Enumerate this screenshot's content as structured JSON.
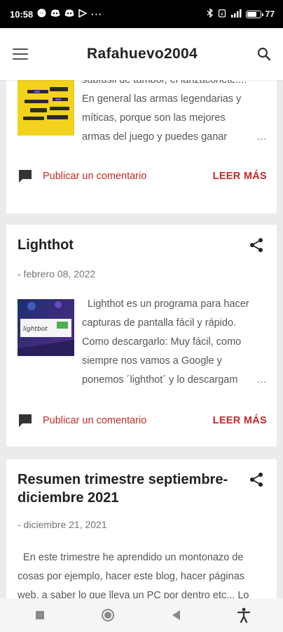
{
  "status_bar": {
    "time": "10:58",
    "notification_icons": [
      "messenger-icon",
      "discord-icon",
      "discord-icon",
      "play-icon"
    ],
    "more": "···",
    "battery_percent": "77",
    "battery_level": 0.77
  },
  "app_bar": {
    "title": "Rafahuevo2004",
    "menu_icon": "menu-icon",
    "search_icon": "search-icon"
  },
  "posts": [
    {
      "snippet_lines": [
        "subfusil de tambor, el lanzacohete....",
        "En general las armas legendarias y",
        "míticas, porque son las mejores",
        "armas del juego y puedes ganar"
      ],
      "ellipsis": "…",
      "comment_label": "Publicar un comentario",
      "read_more": "LEER MÁS"
    },
    {
      "title": "Lighthot",
      "date": "- febrero 08, 2022",
      "snippet_lines": [
        "  Lighthot es un programa para hacer",
        "capturas de pantalla fácil y rápido.",
        "Como descargarlo: Muy fácil, como",
        "siempre nos vamos a Google y",
        "ponemos ´lighthot´ y lo descargam"
      ],
      "ellipsis": "…",
      "comment_label": "Publicar un comentario",
      "read_more": "LEER MÁS"
    },
    {
      "title_lines": [
        "Resumen trimestre septiembre-",
        "diciembre 2021"
      ],
      "date": "- diciembre 21, 2021",
      "snippet_lines": [
        "  En este trimestre he aprendido un montonazo de",
        "cosas por ejemplo, hacer este blog, hacer páginas",
        "web, a saber lo que lleva un PC por dentro etc... Lo"
      ]
    }
  ],
  "colors": {
    "accent": "#c62828",
    "background": "#ebebeb",
    "card": "#ffffff"
  }
}
